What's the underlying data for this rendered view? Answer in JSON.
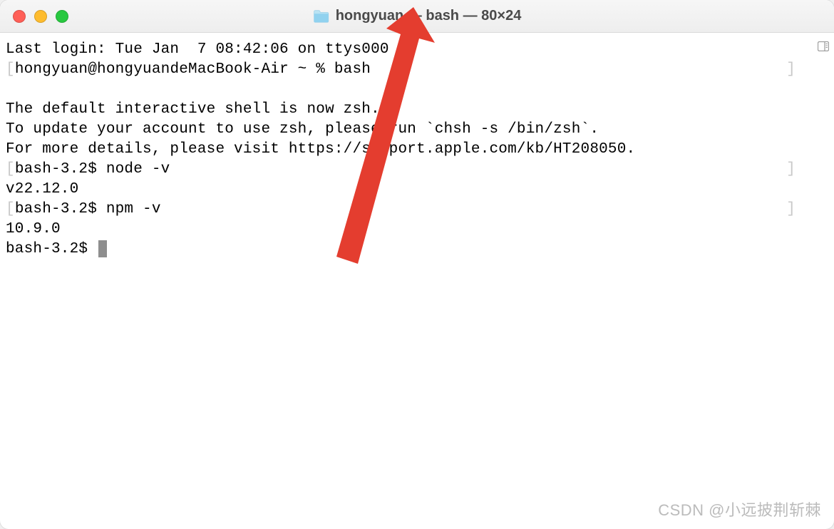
{
  "window": {
    "title": "hongyuan — bash — 80×24"
  },
  "terminal": {
    "lines": [
      {
        "text": "Last login: Tue Jan  7 08:42:06 on ttys000",
        "bracket": false
      },
      {
        "text": "hongyuan@hongyuandeMacBook-Air ~ % bash",
        "bracket": true
      },
      {
        "text": "",
        "bracket": false
      },
      {
        "text": "The default interactive shell is now zsh.",
        "bracket": false
      },
      {
        "text": "To update your account to use zsh, please run `chsh -s /bin/zsh`.",
        "bracket": false
      },
      {
        "text": "For more details, please visit https://support.apple.com/kb/HT208050.",
        "bracket": false
      },
      {
        "text": "bash-3.2$ node -v",
        "bracket": true
      },
      {
        "text": "v22.12.0",
        "bracket": false
      },
      {
        "text": "bash-3.2$ npm -v",
        "bracket": true
      },
      {
        "text": "10.9.0",
        "bracket": false
      }
    ],
    "prompt": "bash-3.2$ "
  },
  "colors": {
    "close": "#ff5f57",
    "minimize": "#febc2e",
    "maximize": "#28c840",
    "arrow": "#e43d2f",
    "folder": "#91d2ef"
  },
  "watermark": "CSDN @小远披荆斩棘"
}
